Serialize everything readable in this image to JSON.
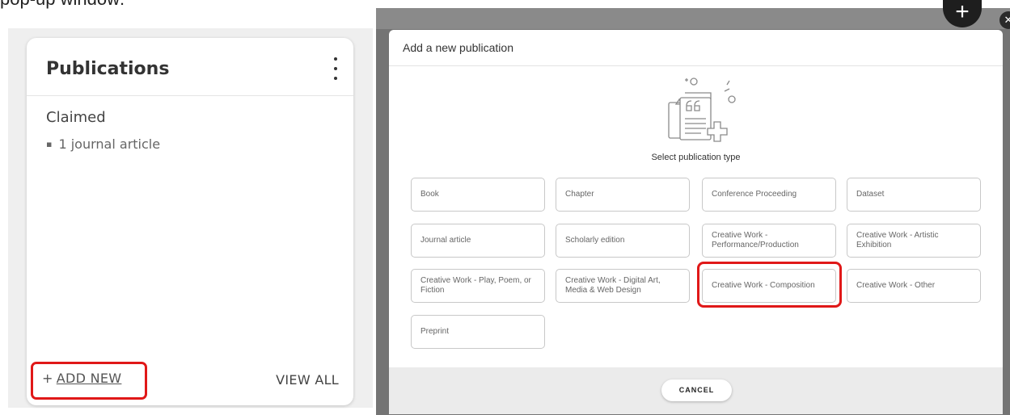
{
  "caption": "pop-up window:",
  "publications_card": {
    "title": "Publications",
    "claimed_label": "Claimed",
    "items": [
      "1 journal article"
    ],
    "add_new_plus": "+",
    "add_new_label": "ADD NEW",
    "view_all_label": "VIEW ALL"
  },
  "background": {
    "fab_label": "+",
    "close_label": "✕"
  },
  "modal": {
    "title": "Add a new publication",
    "select_label": "Select publication type",
    "types": [
      "Book",
      "Chapter",
      "Conference Proceeding",
      "Dataset",
      "Journal article",
      "Scholarly edition",
      "Creative Work - Performance/Production",
      "Creative Work - Artistic Exhibition",
      "Creative Work - Play, Poem, or Fiction",
      "Creative Work - Digital Art, Media & Web Design",
      "Creative Work - Composition",
      "Creative Work - Other",
      "Preprint"
    ],
    "cancel_label": "CANCEL"
  },
  "highlight_color": "#e01818"
}
